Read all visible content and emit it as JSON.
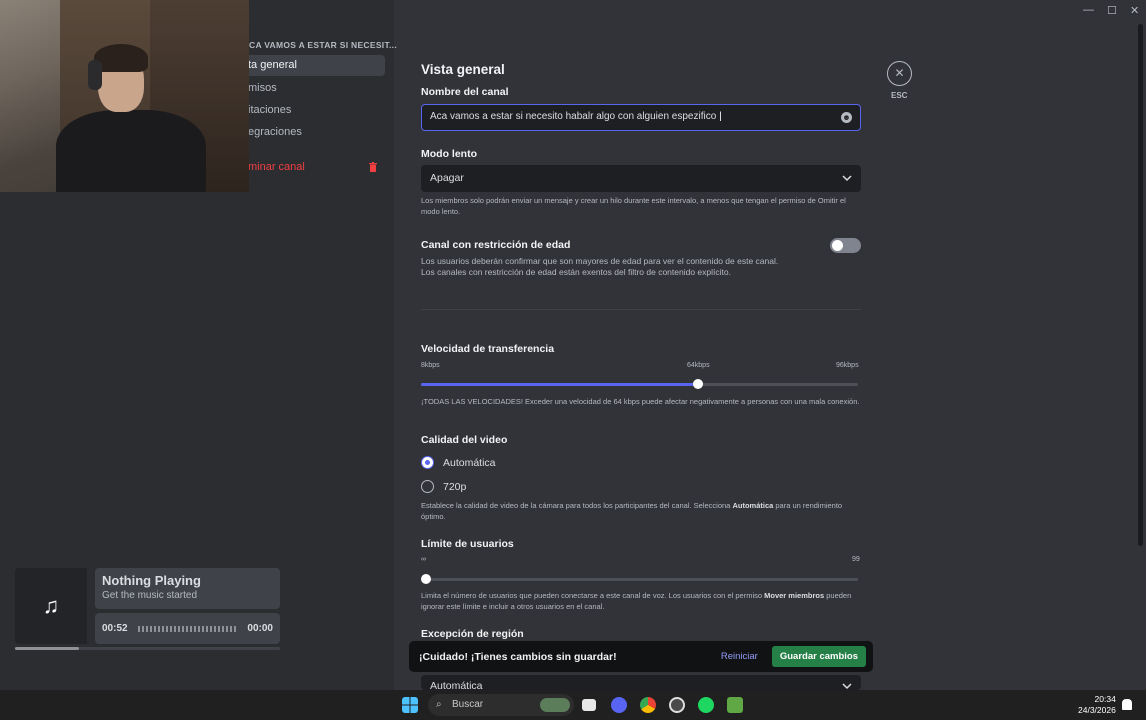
{
  "sidebar": {
    "header": "CA VAMOS A ESTAR SI NECESIT...",
    "items": [
      {
        "label": "ta general",
        "active": true
      },
      {
        "label": "misos"
      },
      {
        "label": "itaciones"
      },
      {
        "label": "egraciones"
      },
      {
        "label": "minar canal",
        "danger": true
      }
    ]
  },
  "music": {
    "title": "Nothing Playing",
    "subtitle": "Get the music started",
    "elapsed": "00:52",
    "remaining": "00:00",
    "progress": 0.24
  },
  "main": {
    "heading": "Vista general",
    "channel_name_label": "Nombre del canal",
    "channel_name_value": "Aca vamos a estar si necesito habalr algo con alguien espezifico",
    "slowmode_label": "Modo lento",
    "slowmode_value": "Apagar",
    "slowmode_help": "Los miembros solo podrán enviar un mensaje y crear un hilo durante este intervalo, a menos que tengan el permiso de Omitir el modo lento.",
    "age_label": "Canal con restricción de edad",
    "age_help_1": "Los usuarios deberán confirmar que son mayores de edad para ver el contenido de este canal.",
    "age_help_2": "Los canales con restricción de edad están exentos del filtro de contenido explícito.",
    "age_enabled": false,
    "bitrate_label": "Velocidad de transferencia",
    "bitrate_ticks": [
      "8kbps",
      "64kbps",
      "96kbps"
    ],
    "bitrate_value_kbps": 64,
    "bitrate_help": "¡TODAS LAS VELOCIDADES! Exceder una velocidad de 64 kbps puede afectar negativamente a personas con una mala conexión.",
    "video_label": "Calidad del video",
    "video_options": [
      "Automática",
      "720p"
    ],
    "video_selected": "Automática",
    "video_help_pre": "Establece la calidad de video de la cámara para todos los participantes del canal. Selecciona ",
    "video_help_bold": "Automática",
    "video_help_post": " para un rendimiento óptimo.",
    "limit_label": "Límite de usuarios",
    "limit_ticks": [
      "∞",
      "99"
    ],
    "limit_value": 0,
    "limit_help_pre": "Limita el número de usuarios que pueden conectarse a este canal de voz. Los usuarios con el permiso ",
    "limit_help_bold": "Mover miembros",
    "limit_help_post": " pueden ignorar este límite e incluir a otros usuarios en el canal.",
    "region_label": "Excepción de región",
    "region_value": "Automática"
  },
  "unsaved": {
    "message": "¡Cuidado! ¡Tienes cambios sin guardar!",
    "reset": "Reiniciar",
    "save": "Guardar cambios"
  },
  "esc": {
    "icon": "close-icon",
    "label": "ESC"
  },
  "taskbar": {
    "search_placeholder": "Buscar",
    "time": "20:34",
    "date": "24/3/2026"
  },
  "colors": {
    "accent": "#5865f2",
    "save": "#248046",
    "danger": "#f23f42"
  }
}
